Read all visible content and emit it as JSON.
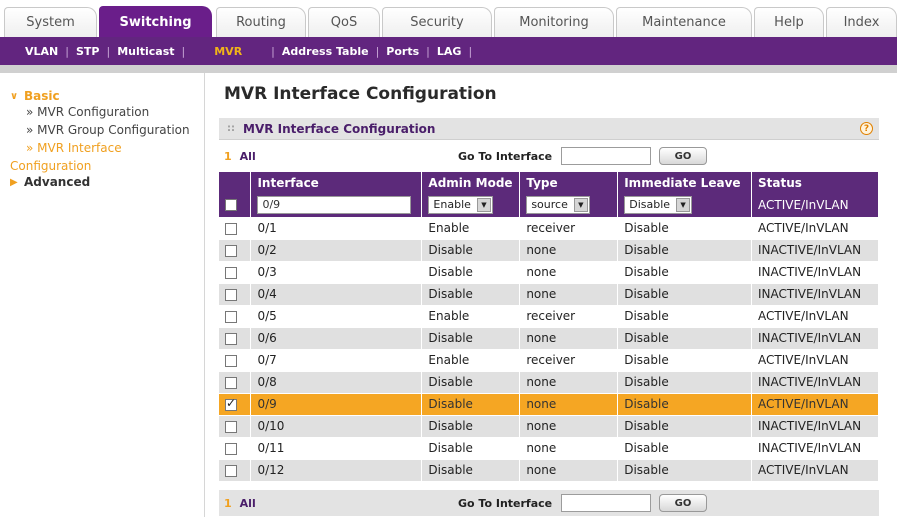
{
  "top_tabs": [
    {
      "label": "System",
      "active": false
    },
    {
      "label": "Switching",
      "active": true
    },
    {
      "label": "Routing",
      "active": false
    },
    {
      "label": "QoS",
      "active": false
    },
    {
      "label": "Security",
      "active": false
    },
    {
      "label": "Monitoring",
      "active": false
    },
    {
      "label": "Maintenance",
      "active": false
    },
    {
      "label": "Help",
      "active": false
    },
    {
      "label": "Index",
      "active": false
    }
  ],
  "subnav": {
    "items": [
      "VLAN",
      "STP",
      "Multicast",
      "MVR",
      "Address Table",
      "Ports",
      "LAG"
    ],
    "active": "MVR"
  },
  "leftnav": {
    "basic_label": "Basic",
    "basic_items": [
      "» MVR Configuration",
      "» MVR Group Configuration",
      "» MVR Interface",
      "Configuration"
    ],
    "advanced_label": "Advanced"
  },
  "page": {
    "title": "MVR Interface Configuration",
    "panel_title": "MVR Interface Configuration",
    "help_symbol": "?"
  },
  "pager": {
    "page_num": "1",
    "all_label": "All",
    "goto_label": "Go To Interface",
    "goto_value": "",
    "go_button": "GO"
  },
  "table": {
    "columns": [
      "Interface",
      "Admin Mode",
      "Type",
      "Immediate Leave",
      "Status"
    ],
    "edit_row": {
      "interface": "0/9",
      "admin_mode": "Enable",
      "type": "source",
      "immediate_leave": "Disable",
      "status": "ACTIVE/InVLAN"
    },
    "rows": [
      {
        "interface": "0/1",
        "admin_mode": "Enable",
        "type": "receiver",
        "immediate_leave": "Disable",
        "status": "ACTIVE/InVLAN",
        "checked": false
      },
      {
        "interface": "0/2",
        "admin_mode": "Disable",
        "type": "none",
        "immediate_leave": "Disable",
        "status": "INACTIVE/InVLAN",
        "checked": false
      },
      {
        "interface": "0/3",
        "admin_mode": "Disable",
        "type": "none",
        "immediate_leave": "Disable",
        "status": "INACTIVE/InVLAN",
        "checked": false
      },
      {
        "interface": "0/4",
        "admin_mode": "Disable",
        "type": "none",
        "immediate_leave": "Disable",
        "status": "INACTIVE/InVLAN",
        "checked": false
      },
      {
        "interface": "0/5",
        "admin_mode": "Enable",
        "type": "receiver",
        "immediate_leave": "Disable",
        "status": "ACTIVE/InVLAN",
        "checked": false
      },
      {
        "interface": "0/6",
        "admin_mode": "Disable",
        "type": "none",
        "immediate_leave": "Disable",
        "status": "INACTIVE/InVLAN",
        "checked": false
      },
      {
        "interface": "0/7",
        "admin_mode": "Enable",
        "type": "receiver",
        "immediate_leave": "Disable",
        "status": "ACTIVE/InVLAN",
        "checked": false
      },
      {
        "interface": "0/8",
        "admin_mode": "Disable",
        "type": "none",
        "immediate_leave": "Disable",
        "status": "INACTIVE/InVLAN",
        "checked": false
      },
      {
        "interface": "0/9",
        "admin_mode": "Disable",
        "type": "none",
        "immediate_leave": "Disable",
        "status": "ACTIVE/InVLAN",
        "checked": true
      },
      {
        "interface": "0/10",
        "admin_mode": "Disable",
        "type": "none",
        "immediate_leave": "Disable",
        "status": "INACTIVE/InVLAN",
        "checked": false
      },
      {
        "interface": "0/11",
        "admin_mode": "Disable",
        "type": "none",
        "immediate_leave": "Disable",
        "status": "INACTIVE/InVLAN",
        "checked": false
      },
      {
        "interface": "0/12",
        "admin_mode": "Disable",
        "type": "none",
        "immediate_leave": "Disable",
        "status": "ACTIVE/InVLAN",
        "checked": false
      }
    ]
  },
  "colors": {
    "brand_purple": "#62257f",
    "accent_orange": "#f5a623",
    "row_gray": "#e0e0e0"
  }
}
